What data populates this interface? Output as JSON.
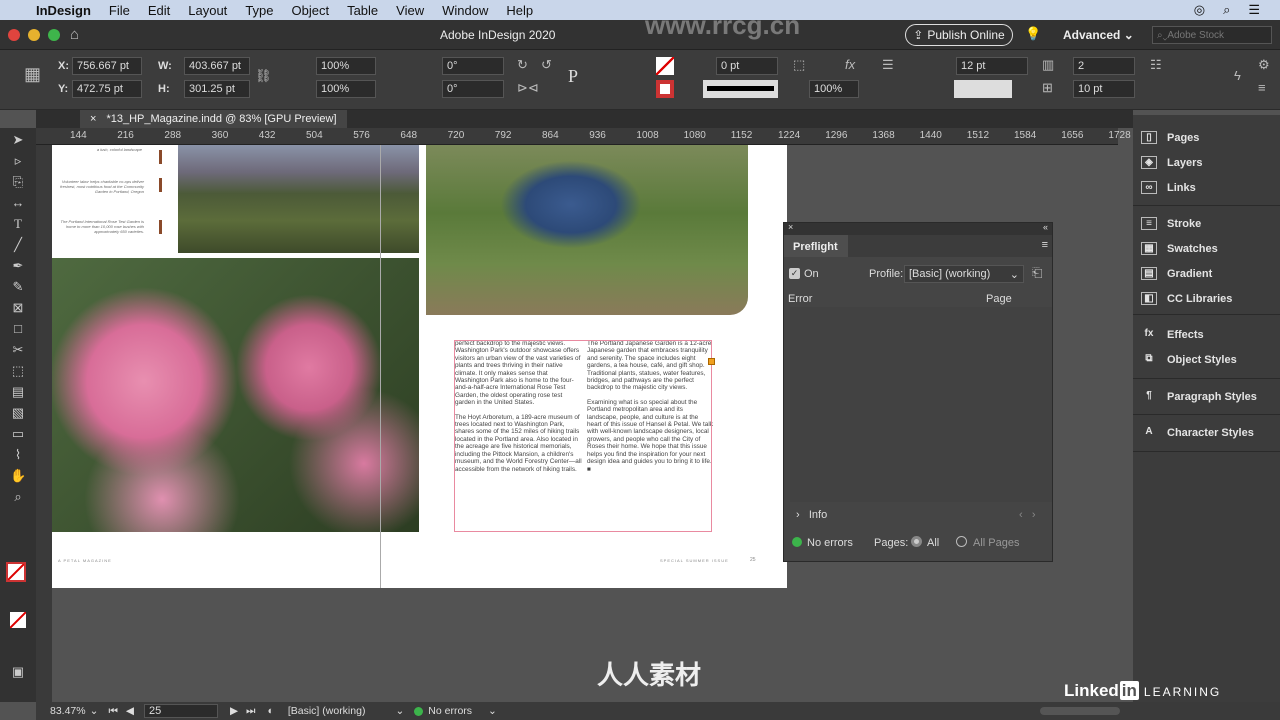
{
  "menubar": {
    "apple": "",
    "items": [
      "InDesign",
      "File",
      "Edit",
      "Layout",
      "Type",
      "Object",
      "Table",
      "View",
      "Window",
      "Help"
    ]
  },
  "titlebar": {
    "title": "Adobe InDesign 2020",
    "publish": "Publish Online",
    "workspace": "Advanced",
    "search_placeholder": "Adobe Stock"
  },
  "control": {
    "x_label": "X:",
    "x": "756.667 pt",
    "y_label": "Y:",
    "y": "472.75 pt",
    "w_label": "W:",
    "w": "403.667 pt",
    "h_label": "H:",
    "h": "301.25 pt",
    "scale_x": "100%",
    "scale_y": "100%",
    "rotate": "0°",
    "shear": "0°",
    "stroke_weight": "0 pt",
    "opacity": "100%",
    "gutter": "12 pt",
    "columns": "2",
    "spacing": "10 pt"
  },
  "document_tab": {
    "close": "×",
    "title": "*13_HP_Magazine.indd @ 83% [GPU Preview]"
  },
  "ruler": [
    "144",
    "216",
    "288",
    "360",
    "432",
    "504",
    "576",
    "648",
    "720",
    "792",
    "864",
    "936",
    "1008",
    "1080",
    "1152",
    "1224",
    "1296",
    "1368",
    "1440",
    "1512",
    "1584",
    "1656",
    "1728"
  ],
  "page": {
    "captions": [
      "a lush, colorful landscape",
      "Volunteer labor helps charitable co-ops deliver freshest, most nutritious food at the Community Garden in Portland, Oregon",
      "The Portland International Rose Test Garden is home to more than 10,000 rose bushes with approximately 650 varieties."
    ],
    "col1": [
      "perfect backdrop to the majestic views. Washington Park's outdoor showcase offers visitors an urban view of the vast varieties of plants and trees thriving in their native climate. It only makes sense that Washington Park also is home to the four-and-a-half-acre International Rose Test Garden, the oldest operating rose test garden in the United States.",
      "The Hoyt Arboretum, a 189-acre museum of trees located next to Washington Park, shares some of the 152 miles of hiking trails located in the Portland area. Also located in the acreage are five historical memorials, including the Pittock Mansion, a children's museum, and the World Forestry Center—all accessible from the network of hiking trails."
    ],
    "col2": [
      "The Portland Japanese Garden is a 12-acre Japanese garden that embraces tranquility and serenity. The space includes eight gardens, a tea house, café, and gift shop. Traditional plants, statues, water features, bridges, and pathways are the perfect backdrop to the majestic city views.",
      "Examining what is so special about the Portland metropolitan area and its landscape, people, and culture is at the heart of this issue of Hansel & Petal. We talk with well-known landscape designers, local growers, and people who call the City of Roses their home. We hope that this issue helps you find the inspiration for your next design idea and guides you to bring it to life. ■"
    ],
    "footer_left": "A PETAL MAGAZINE",
    "footer_right": "SPECIAL SUMMER ISSUE",
    "page_number": "25"
  },
  "preflight": {
    "title": "Preflight",
    "on_label": "On",
    "on_checked": true,
    "profile_label": "Profile:",
    "profile": "[Basic] (working)",
    "col_error": "Error",
    "col_page": "Page",
    "info": "Info",
    "status": "No errors",
    "pages_label": "Pages:",
    "all": "All",
    "all_pages": "All Pages",
    "status_color": "#3cb44b"
  },
  "panels": [
    {
      "label": "Pages",
      "icon": "pages-icon"
    },
    {
      "label": "Layers",
      "icon": "layers-icon"
    },
    {
      "label": "Links",
      "icon": "links-icon"
    },
    {
      "label": "Stroke",
      "icon": "stroke-icon"
    },
    {
      "label": "Swatches",
      "icon": "swatches-icon"
    },
    {
      "label": "Gradient",
      "icon": "gradient-icon"
    },
    {
      "label": "CC Libraries",
      "icon": "cc-libraries-icon"
    },
    {
      "label": "Effects",
      "icon": "fx-icon"
    },
    {
      "label": "Object Styles",
      "icon": "object-styles-icon"
    },
    {
      "label": "Paragraph Styles",
      "icon": "paragraph-styles-icon"
    },
    {
      "label": "Character Styles",
      "icon": "character-styles-icon"
    }
  ],
  "statusbar": {
    "zoom": "83.47%",
    "page": "25",
    "profile": "[Basic] (working)",
    "errors": "No errors"
  },
  "watermark": {
    "brand": "人人素材",
    "linkedin": "Linked",
    "in": "in",
    "learning": "LEARNING",
    "site": "www.rrcg.cn"
  }
}
